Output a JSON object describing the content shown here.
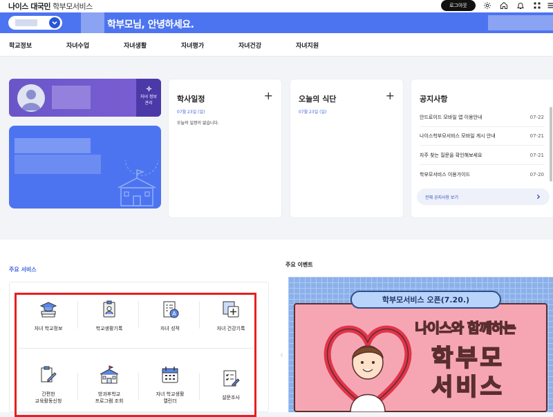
{
  "header": {
    "brand": "나이스 대국민",
    "brand_sub": "학부모서비스",
    "logout_label": "로그아웃",
    "icons": [
      "gear-icon",
      "home-icon",
      "bell-icon",
      "grid-icon",
      "menu-icon"
    ]
  },
  "bluebar": {
    "greeting": "학부모님, 안녕하세요."
  },
  "nav": {
    "items": [
      "학교정보",
      "자녀수업",
      "자녀생활",
      "자녀평가",
      "자녀건강",
      "자녀지원"
    ]
  },
  "profile": {
    "manage_label_1": "자녀 정보",
    "manage_label_2": "관리"
  },
  "schedule": {
    "title": "학사일정",
    "date": "07월 23일 (일)",
    "empty": "오늘의 일정이 없습니다."
  },
  "meal": {
    "title": "오늘의 식단",
    "date": "07월 23일 (일)"
  },
  "notice": {
    "title": "공지사항",
    "items": [
      {
        "text": "안드로이드 모바일 앱 이용안내",
        "date": "07-22"
      },
      {
        "text": "나이스학부모서비스 모바일 게시 안내",
        "date": "07-21"
      },
      {
        "text": "자주 찾는 질문을 확인해보세요",
        "date": "07-21"
      },
      {
        "text": "학부모서비스 이용가이드",
        "date": "07-20"
      }
    ],
    "all_label": "전체 공지사항 보기"
  },
  "services": {
    "title": "주요 서비스",
    "items": [
      {
        "label1": "자녀 학교정보",
        "label2": ""
      },
      {
        "label1": "학교생활기록",
        "label2": ""
      },
      {
        "label1": "자녀 성적",
        "label2": ""
      },
      {
        "label1": "자녀 건강기록",
        "label2": ""
      },
      {
        "label1": "간편한",
        "label2": "교육활동신청"
      },
      {
        "label1": "방과후학교",
        "label2": "프로그램 조회"
      },
      {
        "label1": "자녀 학교생활",
        "label2": "캘린더"
      },
      {
        "label1": "설문조사",
        "label2": ""
      }
    ]
  },
  "events": {
    "title": "주요 이벤트",
    "banner": "학부모서비스 오픈(7.20.)",
    "line1": "나이스와 함께하는",
    "line2": "학부모",
    "line3": "서비스"
  },
  "colors": {
    "accent": "#4d74f0",
    "profile": "#6a56c8",
    "highlight": "#e81e1e"
  }
}
